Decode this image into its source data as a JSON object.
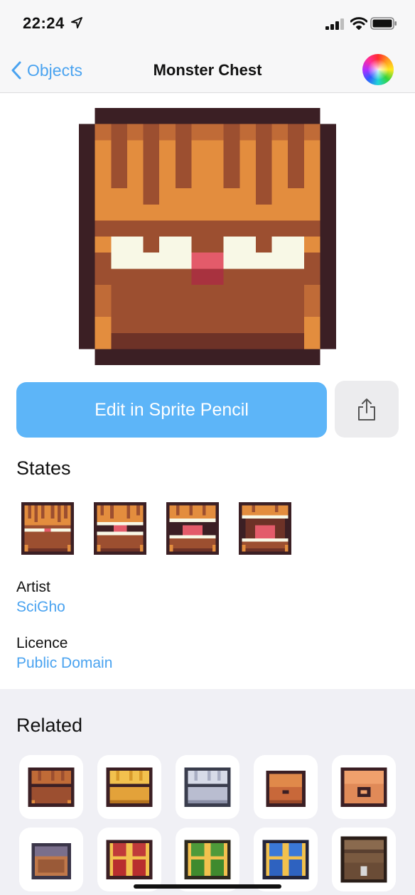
{
  "status": {
    "time": "22:24"
  },
  "nav": {
    "back_label": "Objects",
    "title": "Monster Chest"
  },
  "actions": {
    "edit_label": "Edit in Sprite Pencil"
  },
  "states": {
    "title": "States",
    "items": [
      "state-1",
      "state-2",
      "state-3",
      "state-4"
    ]
  },
  "artist": {
    "label": "Artist",
    "value": "SciGho"
  },
  "licence": {
    "label": "Licence",
    "value": "Public Domain"
  },
  "related": {
    "title": "Related",
    "items": [
      "brown-chest",
      "gold-chest",
      "silver-chest",
      "copper-chest-side",
      "copper-chest-front",
      "stone-chest",
      "red-gem-chest",
      "green-gem-chest",
      "blue-gem-chest",
      "wooden-chest"
    ]
  },
  "colors": {
    "accent": "#4aa3f0",
    "edit_button": "#5db5f8",
    "chest_outline": "#3b1f24",
    "chest_light": "#e38d3e",
    "chest_dark": "#9c4f30",
    "chest_mid": "#c06b37",
    "teeth": "#f8f8e6",
    "tongue": "#e35b6a"
  }
}
